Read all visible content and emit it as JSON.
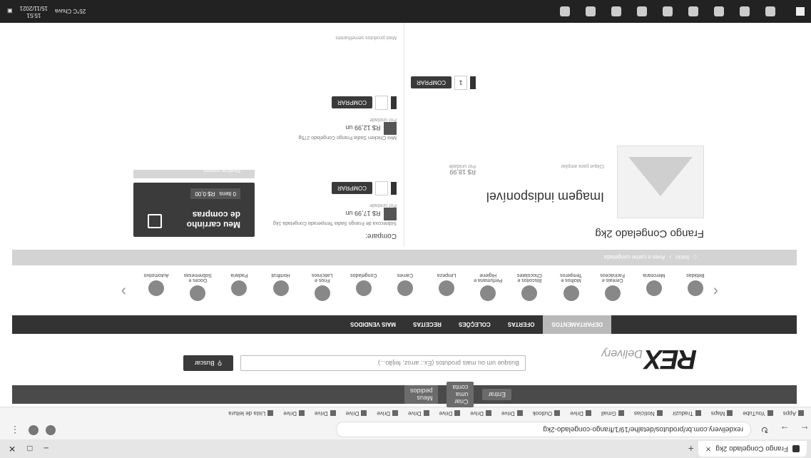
{
  "browser": {
    "tab_title": "Frango Congelado 2kg",
    "url": "rexdelivery.com.br/produtos/detalhe/19/1/frango-congelado-2kg",
    "bookmarks": [
      "Apps",
      "YouTube",
      "Maps",
      "Traduzir",
      "Notícias",
      "Gmail",
      "Drive",
      "Outlook",
      "Drive",
      "Drive",
      "Drive",
      "Drive",
      "Drive",
      "Drive",
      "Drive",
      "Drive",
      "Lista de leitura"
    ]
  },
  "site": {
    "topbar": {
      "login": "Entrar",
      "create_account": "Criar uma conta",
      "track": "Meus pedidos"
    },
    "logo": {
      "brand": "REX",
      "sub": "Delivery"
    },
    "search": {
      "placeholder": "Busque um ou mais produtos (Ex.: arroz, feijão...)",
      "button": "Buscar"
    },
    "nav": [
      "DEPARTAMENTOS",
      "OFERTAS",
      "COLEÇÕES",
      "RECEITAS",
      "MAIS VENDIDOS"
    ],
    "categories": [
      "Bebidas",
      "Mercearia",
      "Cereais e Farináceos",
      "Molhos e Temperos",
      "Biscoitos e Chocolates",
      "Perfumaria e Higiene",
      "Limpeza",
      "Carnes",
      "Congelados",
      "Frios e Laticínios",
      "Hortifruti",
      "Padaria",
      "Doces e Sobremesas",
      "Automotivo"
    ],
    "breadcrumb": {
      "home": "Início",
      "trail": "Aves e carne congelada"
    }
  },
  "product": {
    "title": "Frango Congelado 2kg",
    "image_alt": "Imagem indisponível",
    "view_note": "Clique para ampliar",
    "price": "R$ 18,99",
    "price_note": "Por unidade",
    "qty": "1",
    "buy_label": "COMPRAR"
  },
  "compare": {
    "title": "Compare:",
    "items": [
      {
        "name": "Sobrecoxa de Frango Sadia Temperada Congelada 1kg",
        "price": "R$ 17,99 un",
        "note": "Por unidade",
        "buy": "COMPRAR"
      },
      {
        "name": "Mini Chicken Sadia Frango Congelado 275g",
        "price": "R$ 12,99 un",
        "note": "Por unidade",
        "buy": "COMPRAR"
      }
    ],
    "more": "Mais produtos semelhantes"
  },
  "cart": {
    "title_line1": "Meu carrinho",
    "title_line2": "de compras",
    "items": "0 itens",
    "total": "R$ 0,00",
    "checkout": "Finalizar compra"
  },
  "taskbar": {
    "weather": "25°C Chuva",
    "time": "15:51",
    "date": "15/11/2021"
  }
}
